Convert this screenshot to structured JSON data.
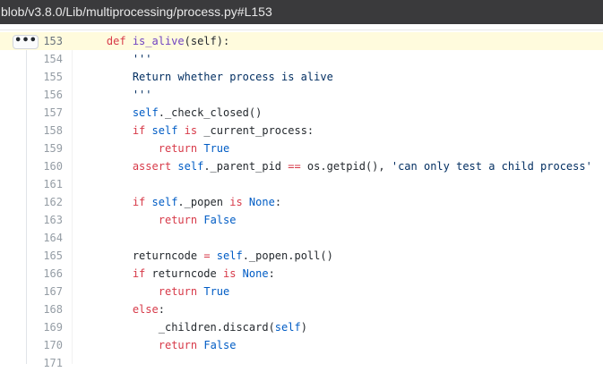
{
  "url": "blob/v3.8.0/Lib/multiprocessing/process.py#L153",
  "ellipsis_label": "•••",
  "lines": [
    {
      "num": "153",
      "highlight": true,
      "indent": 4,
      "tokens": [
        [
          "k",
          "def"
        ],
        [
          "",
          " "
        ],
        [
          "f",
          "is_alive"
        ],
        [
          "",
          "(self):"
        ]
      ]
    },
    {
      "num": "154",
      "highlight": false,
      "indent": 8,
      "tokens": [
        [
          "s",
          "'''"
        ]
      ]
    },
    {
      "num": "155",
      "highlight": false,
      "indent": 8,
      "tokens": [
        [
          "s",
          "Return whether process is alive"
        ]
      ]
    },
    {
      "num": "156",
      "highlight": false,
      "indent": 8,
      "tokens": [
        [
          "s",
          "'''"
        ]
      ]
    },
    {
      "num": "157",
      "highlight": false,
      "indent": 8,
      "tokens": [
        [
          "c",
          "self"
        ],
        [
          "",
          "._check_closed()"
        ]
      ]
    },
    {
      "num": "158",
      "highlight": false,
      "indent": 8,
      "tokens": [
        [
          "k",
          "if"
        ],
        [
          "",
          " "
        ],
        [
          "c",
          "self"
        ],
        [
          "",
          " "
        ],
        [
          "k",
          "is"
        ],
        [
          "",
          " _current_process:"
        ]
      ]
    },
    {
      "num": "159",
      "highlight": false,
      "indent": 12,
      "tokens": [
        [
          "k",
          "return"
        ],
        [
          "",
          " "
        ],
        [
          "c",
          "True"
        ]
      ]
    },
    {
      "num": "160",
      "highlight": false,
      "indent": 8,
      "tokens": [
        [
          "k",
          "assert"
        ],
        [
          "",
          " "
        ],
        [
          "c",
          "self"
        ],
        [
          "",
          "._parent_pid "
        ],
        [
          "k",
          "=="
        ],
        [
          "",
          " os.getpid(), "
        ],
        [
          "s",
          "'can only test a child process'"
        ]
      ]
    },
    {
      "num": "161",
      "highlight": false,
      "indent": 0,
      "tokens": []
    },
    {
      "num": "162",
      "highlight": false,
      "indent": 8,
      "tokens": [
        [
          "k",
          "if"
        ],
        [
          "",
          " "
        ],
        [
          "c",
          "self"
        ],
        [
          "",
          "._popen "
        ],
        [
          "k",
          "is"
        ],
        [
          "",
          " "
        ],
        [
          "c",
          "None"
        ],
        [
          "",
          ":"
        ]
      ]
    },
    {
      "num": "163",
      "highlight": false,
      "indent": 12,
      "tokens": [
        [
          "k",
          "return"
        ],
        [
          "",
          " "
        ],
        [
          "c",
          "False"
        ]
      ]
    },
    {
      "num": "164",
      "highlight": false,
      "indent": 0,
      "tokens": []
    },
    {
      "num": "165",
      "highlight": false,
      "indent": 8,
      "tokens": [
        [
          "",
          "returncode "
        ],
        [
          "k",
          "="
        ],
        [
          "",
          " "
        ],
        [
          "c",
          "self"
        ],
        [
          "",
          "._popen.poll()"
        ]
      ]
    },
    {
      "num": "166",
      "highlight": false,
      "indent": 8,
      "tokens": [
        [
          "k",
          "if"
        ],
        [
          "",
          " returncode "
        ],
        [
          "k",
          "is"
        ],
        [
          "",
          " "
        ],
        [
          "c",
          "None"
        ],
        [
          "",
          ":"
        ]
      ]
    },
    {
      "num": "167",
      "highlight": false,
      "indent": 12,
      "tokens": [
        [
          "k",
          "return"
        ],
        [
          "",
          " "
        ],
        [
          "c",
          "True"
        ]
      ]
    },
    {
      "num": "168",
      "highlight": false,
      "indent": 8,
      "tokens": [
        [
          "k",
          "else"
        ],
        [
          "",
          ":"
        ]
      ]
    },
    {
      "num": "169",
      "highlight": false,
      "indent": 12,
      "tokens": [
        [
          "",
          "_children.discard("
        ],
        [
          "c",
          "self"
        ],
        [
          "",
          ")"
        ]
      ]
    },
    {
      "num": "170",
      "highlight": false,
      "indent": 12,
      "tokens": [
        [
          "k",
          "return"
        ],
        [
          "",
          " "
        ],
        [
          "c",
          "False"
        ]
      ]
    },
    {
      "num": "171",
      "highlight": false,
      "indent": 0,
      "tokens": []
    }
  ]
}
